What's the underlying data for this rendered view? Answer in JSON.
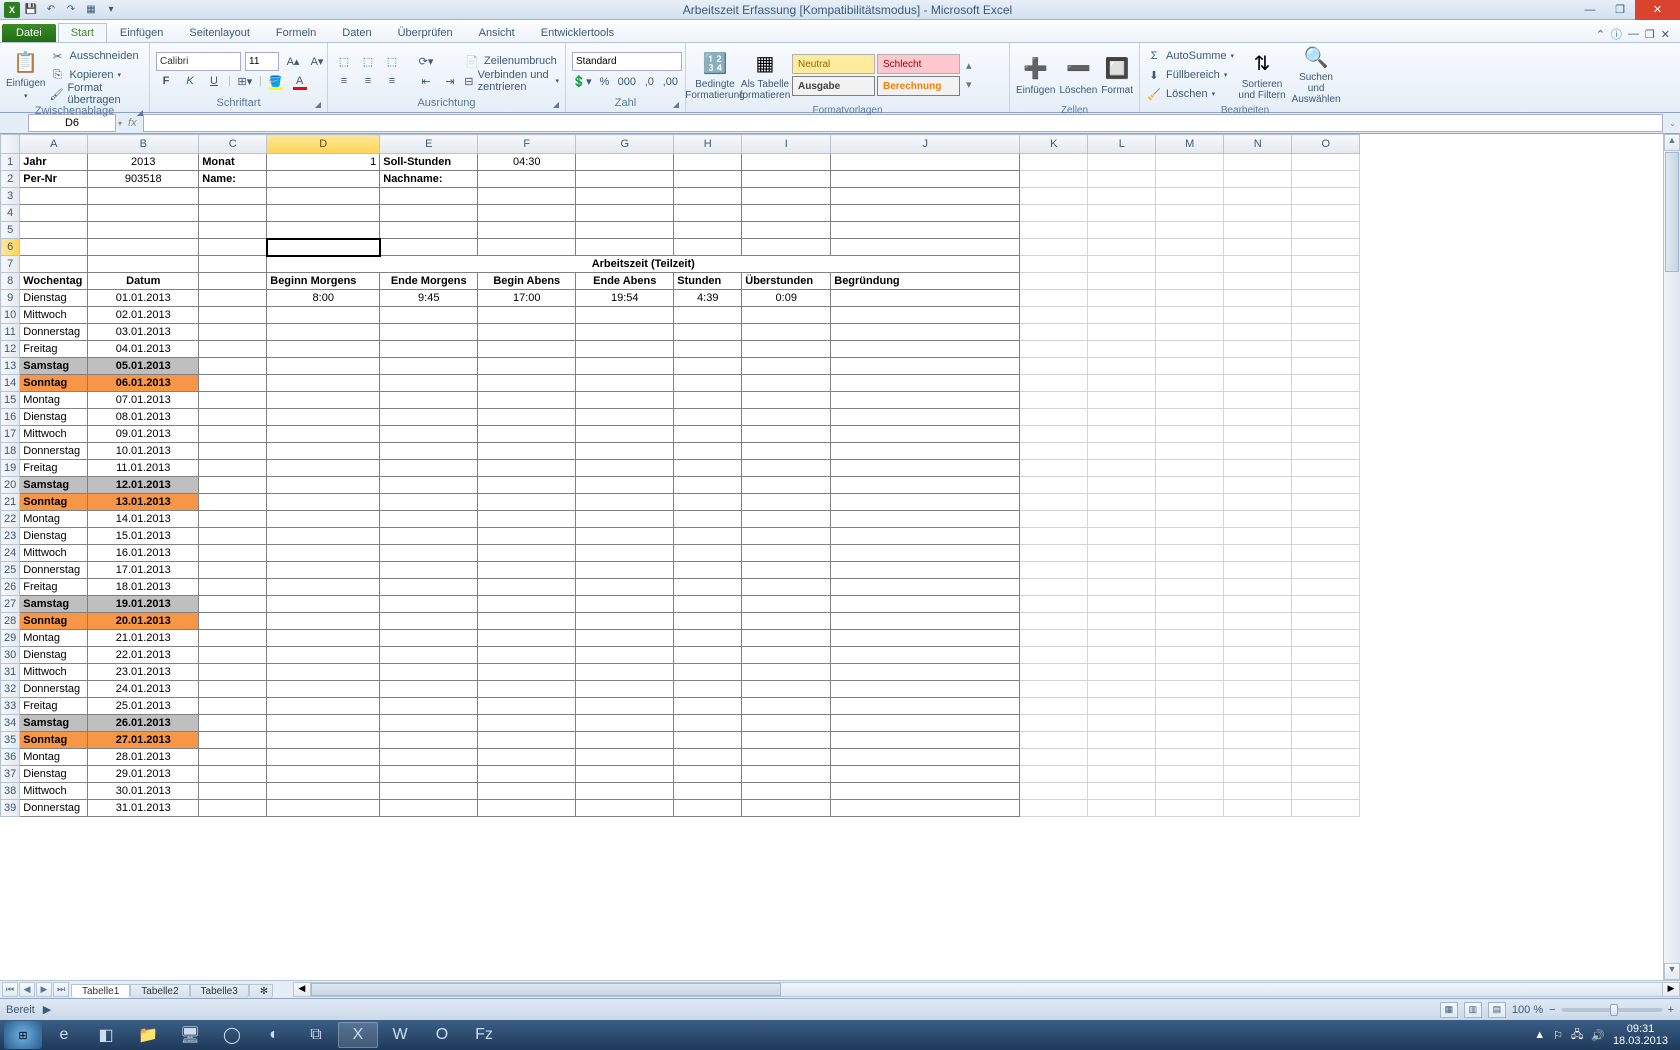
{
  "title": "Arbeitszeit Erfassung  [Kompatibilitätsmodus] - Microsoft Excel",
  "qat": {
    "save": "💾",
    "undo": "↶",
    "redo": "↷",
    "print": "🖨"
  },
  "tabs": {
    "file": "Datei",
    "home": "Start",
    "insert": "Einfügen",
    "layout": "Seitenlayout",
    "formulas": "Formeln",
    "data": "Daten",
    "review": "Überprüfen",
    "view": "Ansicht",
    "dev": "Entwicklertools"
  },
  "clipboard": {
    "paste": "Einfügen",
    "cut": "Ausschneiden",
    "copy": "Kopieren",
    "format": "Format übertragen",
    "label": "Zwischenablage"
  },
  "font": {
    "name": "Calibri",
    "size": "11",
    "label": "Schriftart"
  },
  "align": {
    "wrap": "Zeilenumbruch",
    "merge": "Verbinden und zentrieren",
    "label": "Ausrichtung"
  },
  "number": {
    "format": "Standard",
    "label": "Zahl"
  },
  "styles": {
    "cond": "Bedingte Formatierung",
    "table": "Als Tabelle formatieren",
    "neutral": "Neutral",
    "bad": "Schlecht",
    "output": "Ausgabe",
    "calc": "Berechnung",
    "label": "Formatvorlagen"
  },
  "cells": {
    "insert": "Einfügen",
    "delete": "Löschen",
    "format": "Format",
    "label": "Zellen"
  },
  "editing": {
    "sum": "AutoSumme",
    "fill": "Füllbereich",
    "clear": "Löschen",
    "sort": "Sortieren und Filtern",
    "find": "Suchen und Auswählen",
    "label": "Bearbeiten"
  },
  "namebox": "D6",
  "cols": [
    "A",
    "B",
    "C",
    "D",
    "E",
    "F",
    "G",
    "H",
    "I",
    "J",
    "K",
    "L",
    "M",
    "N",
    "O"
  ],
  "header": {
    "r1": {
      "a": "Jahr",
      "b": "2013",
      "c": "Monat",
      "d": "1",
      "e": "Soll-Stunden",
      "f": "04:30"
    },
    "r2": {
      "a": "Per-Nr",
      "b": "903518",
      "c": "Name:",
      "e": "Nachname:"
    }
  },
  "section": "Arbeitszeit (Teilzeit)",
  "colh": {
    "a": "Wochentag",
    "b": "Datum",
    "d": "Beginn Morgens",
    "e": "Ende Morgens",
    "f": "Begin Abens",
    "g": "Ende Abens",
    "h": "Stunden",
    "i": "Überstunden",
    "j": "Begründung"
  },
  "rows": [
    {
      "n": 9,
      "wd": "Dienstag",
      "d": "01.01.2013",
      "bm": "8:00",
      "em": "9:45",
      "ba": "17:00",
      "ea": "19:54",
      "st": "4:39",
      "ue": "0:09",
      "t": ""
    },
    {
      "n": 10,
      "wd": "Mittwoch",
      "d": "02.01.2013",
      "t": ""
    },
    {
      "n": 11,
      "wd": "Donnerstag",
      "d": "03.01.2013",
      "t": ""
    },
    {
      "n": 12,
      "wd": "Freitag",
      "d": "04.01.2013",
      "t": ""
    },
    {
      "n": 13,
      "wd": "Samstag",
      "d": "05.01.2013",
      "t": "sat"
    },
    {
      "n": 14,
      "wd": "Sonntag",
      "d": "06.01.2013",
      "t": "sun"
    },
    {
      "n": 15,
      "wd": "Montag",
      "d": "07.01.2013",
      "t": ""
    },
    {
      "n": 16,
      "wd": "Dienstag",
      "d": "08.01.2013",
      "t": ""
    },
    {
      "n": 17,
      "wd": "Mittwoch",
      "d": "09.01.2013",
      "t": ""
    },
    {
      "n": 18,
      "wd": "Donnerstag",
      "d": "10.01.2013",
      "t": ""
    },
    {
      "n": 19,
      "wd": "Freitag",
      "d": "11.01.2013",
      "t": ""
    },
    {
      "n": 20,
      "wd": "Samstag",
      "d": "12.01.2013",
      "t": "sat"
    },
    {
      "n": 21,
      "wd": "Sonntag",
      "d": "13.01.2013",
      "t": "sun"
    },
    {
      "n": 22,
      "wd": "Montag",
      "d": "14.01.2013",
      "t": ""
    },
    {
      "n": 23,
      "wd": "Dienstag",
      "d": "15.01.2013",
      "t": ""
    },
    {
      "n": 24,
      "wd": "Mittwoch",
      "d": "16.01.2013",
      "t": ""
    },
    {
      "n": 25,
      "wd": "Donnerstag",
      "d": "17.01.2013",
      "t": ""
    },
    {
      "n": 26,
      "wd": "Freitag",
      "d": "18.01.2013",
      "t": ""
    },
    {
      "n": 27,
      "wd": "Samstag",
      "d": "19.01.2013",
      "t": "sat"
    },
    {
      "n": 28,
      "wd": "Sonntag",
      "d": "20.01.2013",
      "t": "sun"
    },
    {
      "n": 29,
      "wd": "Montag",
      "d": "21.01.2013",
      "t": ""
    },
    {
      "n": 30,
      "wd": "Dienstag",
      "d": "22.01.2013",
      "t": ""
    },
    {
      "n": 31,
      "wd": "Mittwoch",
      "d": "23.01.2013",
      "t": ""
    },
    {
      "n": 32,
      "wd": "Donnerstag",
      "d": "24.01.2013",
      "t": ""
    },
    {
      "n": 33,
      "wd": "Freitag",
      "d": "25.01.2013",
      "t": ""
    },
    {
      "n": 34,
      "wd": "Samstag",
      "d": "26.01.2013",
      "t": "sat"
    },
    {
      "n": 35,
      "wd": "Sonntag",
      "d": "27.01.2013",
      "t": "sun"
    },
    {
      "n": 36,
      "wd": "Montag",
      "d": "28.01.2013",
      "t": ""
    },
    {
      "n": 37,
      "wd": "Dienstag",
      "d": "29.01.2013",
      "t": ""
    },
    {
      "n": 38,
      "wd": "Mittwoch",
      "d": "30.01.2013",
      "t": ""
    },
    {
      "n": 39,
      "wd": "Donnerstag",
      "d": "31.01.2013",
      "t": ""
    }
  ],
  "sheets": [
    "Tabelle1",
    "Tabelle2",
    "Tabelle3"
  ],
  "status": {
    "ready": "Bereit",
    "zoom": "100 %"
  },
  "tray": {
    "time": "09:31",
    "date": "18.03.2013"
  }
}
